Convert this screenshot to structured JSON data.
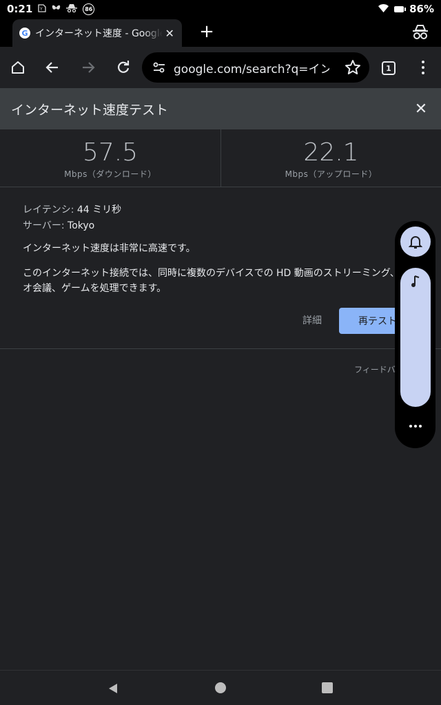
{
  "status_bar": {
    "time": "0:21",
    "icons": [
      "sim-icon",
      "butterfly-icon",
      "incognito-icon",
      "badge-icon"
    ],
    "badge": "86",
    "battery": "86%"
  },
  "tab": {
    "title": "インターネット速度 - Google",
    "favicon": "G"
  },
  "toolbar": {
    "url": "google.com/search?q=インタ",
    "tab_count": "1"
  },
  "card": {
    "title": "インターネット速度テスト",
    "download": {
      "value": "57.5",
      "unit": "Mbps（ダウンロード）"
    },
    "upload": {
      "value": "22.1",
      "unit": "Mbps（アップロード）"
    },
    "latency_label": "レイテンシ: ",
    "latency_value": "44 ミリ秒",
    "server_label": "サーバー: ",
    "server_value": "Tokyo",
    "summary": "インターネット速度は非常に高速です。",
    "description": "このインターネット接続では、同時に複数のデバイスでの HD 動画のストリーミング、ビデオ会議、ゲームを処理できます。",
    "details_label": "詳細",
    "retest_label": "再テスト",
    "feedback_label": "フィードバック"
  },
  "colors": {
    "accent": "#8ab4f8",
    "background": "#202124",
    "header": "#3c4043",
    "panel_pill": "#c8d3f3"
  }
}
